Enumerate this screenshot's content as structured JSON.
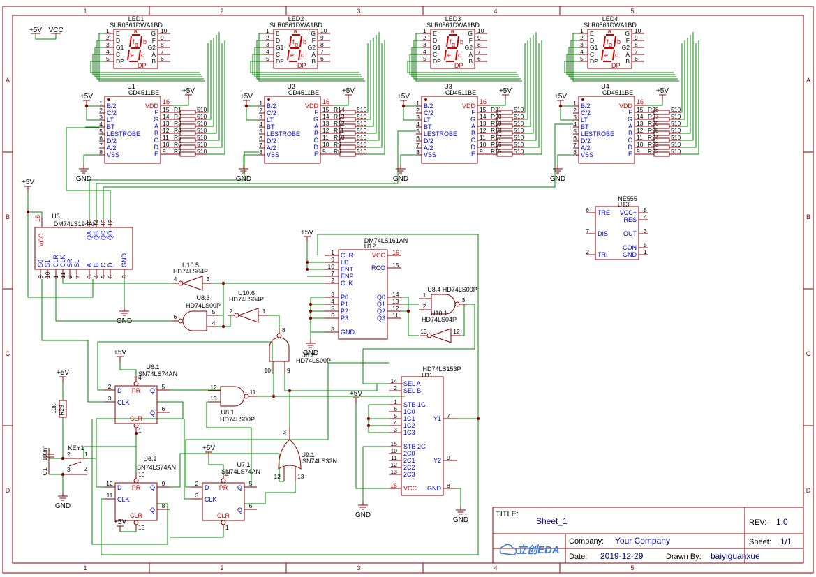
{
  "frame": {
    "columns": [
      "1",
      "2",
      "3",
      "4",
      "5"
    ],
    "rows": [
      "A",
      "B",
      "C",
      "D"
    ]
  },
  "power": {
    "plus5v": "+5V",
    "vcc": "VCC",
    "gnd": "GND"
  },
  "displays": [
    {
      "ref": "LED1",
      "part": "SLR0561DWA1BD"
    },
    {
      "ref": "LED2",
      "part": "SLR0561DWA1BD"
    },
    {
      "ref": "LED3",
      "part": "SLR0561DWA1BD"
    },
    {
      "ref": "LED4",
      "part": "SLR0561DWA1BD"
    }
  ],
  "display_pins": {
    "left_nums": [
      "1",
      "2",
      "3",
      "4",
      "5"
    ],
    "left_names": [
      "E",
      "D",
      "G1",
      "C",
      "DP"
    ],
    "right_names": [
      "G",
      "F",
      "G2",
      "A",
      "B"
    ],
    "right_nums": [
      "10",
      "9",
      "8",
      "7",
      "6"
    ],
    "seg_letters": [
      "a",
      "f",
      "g",
      "b",
      "e",
      "c",
      "DP"
    ]
  },
  "decoders": [
    {
      "ref": "U1",
      "part": "CD4511BE",
      "resistors": [
        "R1",
        "R2",
        "R3",
        "R4",
        "R5",
        "R6",
        "R7"
      ]
    },
    {
      "ref": "U2",
      "part": "CD4511BE",
      "resistors": [
        "R14",
        "R13",
        "R12",
        "R11",
        "R10",
        "R9",
        "R8"
      ]
    },
    {
      "ref": "U3",
      "part": "CD4511BE",
      "resistors": [
        "R21",
        "R20",
        "R19",
        "R18",
        "R17",
        "R16",
        "R15"
      ]
    },
    {
      "ref": "U4",
      "part": "CD4511BE",
      "resistors": [
        "R28",
        "R27",
        "R26",
        "R25",
        "R24",
        "R23",
        "R22"
      ]
    }
  ],
  "decoder_pins": {
    "left_nums": [
      "1",
      "2",
      "3",
      "4",
      "5",
      "6",
      "7",
      "8"
    ],
    "left_names": [
      "B/2",
      "C/2",
      "LT",
      "BT",
      "LESTROBE",
      "D/2",
      "A/2",
      "VSS"
    ],
    "vdd_label": "VDD",
    "vdd_num": "16",
    "right_names": [
      "F",
      "G",
      "A",
      "B",
      "C",
      "D",
      "E"
    ],
    "right_nums": [
      "15",
      "14",
      "13",
      "12",
      "11",
      "10",
      "9"
    ],
    "res_value": "510"
  },
  "u5": {
    "ref": "U5",
    "part": "DM74LS194AN",
    "vcc_label": "VCC",
    "vcc_num": "16",
    "top_names": [
      "QA",
      "QB",
      "QC",
      "QD"
    ],
    "top_nums": [
      "15",
      "14",
      "13",
      "12"
    ],
    "bottom_names": [
      "S0",
      "S1",
      "CLR",
      "CLK",
      "SR",
      "SL",
      "A",
      "B",
      "C",
      "D",
      "GND"
    ],
    "bottom_nums": [
      "9",
      "10",
      "1",
      "11",
      "2",
      "7",
      "3",
      "4",
      "5",
      "6",
      "8"
    ]
  },
  "u12": {
    "ref": "U12",
    "part": "DM74LS161AN",
    "left_names": [
      "CLR",
      "LD",
      "ENT",
      "ENP",
      "CLK",
      "P0",
      "P1",
      "P2",
      "P3",
      "GND"
    ],
    "left_nums": [
      "1",
      "9",
      "10",
      "7",
      "2",
      "3",
      "4",
      "5",
      "6",
      "8"
    ],
    "right_names": [
      "VCC",
      "RCO",
      "Q0",
      "Q1",
      "Q2",
      "Q3"
    ],
    "right_nums": [
      "16",
      "15",
      "14",
      "13",
      "12",
      "11"
    ]
  },
  "u13": {
    "ref": "U13",
    "part": "NE555",
    "left_names": [
      "TRE",
      "DIS",
      "TRI"
    ],
    "left_nums": [
      "6",
      "7",
      "2"
    ],
    "right_names": [
      "VCC+",
      "RES",
      "OUT",
      "CON",
      "GND"
    ],
    "right_nums": [
      "8",
      "4",
      "3",
      "5",
      "1"
    ]
  },
  "u11": {
    "ref": "U11",
    "part": "HD74LS153P",
    "left_names": [
      "SEL A",
      "SEL B",
      "STB 1G",
      "1C0",
      "1C1",
      "1C2",
      "1C3",
      "STB 2G",
      "2C0",
      "2C1",
      "2C2",
      "2C3",
      "VCC"
    ],
    "left_nums": [
      "14",
      "2",
      "1",
      "6",
      "5",
      "4",
      "3",
      "15",
      "10",
      "11",
      "12",
      "13",
      "16"
    ],
    "right_names": [
      "Y1",
      "Y2",
      "GND"
    ],
    "right_nums": [
      "7",
      "9",
      "8"
    ]
  },
  "gates": [
    {
      "ref": "U10.5",
      "part": "HD74LS04P",
      "pins": [
        "4",
        "3"
      ]
    },
    {
      "ref": "U10.6",
      "part": "HD74LS04P",
      "pins": [
        "2",
        "1"
      ]
    },
    {
      "ref": "U8.3",
      "part": "HD74LS00P",
      "pins": [
        "6",
        "5",
        "4"
      ]
    },
    {
      "ref": "U8.4",
      "part": "HD74LS00P",
      "pins": [
        "1",
        "2",
        "3"
      ]
    },
    {
      "ref": "U10.1",
      "part": "HD74LS04P",
      "pins": [
        "13",
        "12"
      ]
    },
    {
      "ref": "U8.2",
      "part": "HD74LS00P",
      "pins": [
        "8",
        "10",
        "9"
      ]
    },
    {
      "ref": "U8.1",
      "part": "HD74LS00P",
      "pins": [
        "12",
        "13",
        "11"
      ]
    },
    {
      "ref": "U9.1",
      "part": "SN74LS32N",
      "pins": [
        "3",
        "12",
        "13"
      ]
    }
  ],
  "flipflops": [
    {
      "ref": "U6.1",
      "part": "SN74LS74AN",
      "pins": {
        "pr": "4",
        "d": "2",
        "q": "5",
        "clk": "3",
        "qn": "6",
        "clr": "1"
      }
    },
    {
      "ref": "U6.2",
      "part": "SN74LS74AN",
      "pins": {
        "pr": "10",
        "d": "12",
        "q": "9",
        "clk": "11",
        "qn": "8",
        "clr": "13"
      }
    },
    {
      "ref": "U7.1",
      "part": "SN74LS74AN",
      "pins": {
        "pr": "4",
        "d": "2",
        "q": "5",
        "clk": "3",
        "qn": "6",
        "clr": "1"
      }
    }
  ],
  "ff_labels": {
    "d": "D",
    "pr": "PR",
    "q": "Q",
    "clk": "CLK",
    "clr": "CLR"
  },
  "r29": {
    "ref": "R29",
    "value": "10k"
  },
  "c1": {
    "ref": "C1",
    "value": "100nf"
  },
  "key1": {
    "ref": "KEY1",
    "pins": [
      "2",
      "1",
      "3",
      "4"
    ]
  },
  "titleblock": {
    "title_label": "TITLE:",
    "title": "Sheet_1",
    "rev_label": "REV:",
    "rev": "1.0",
    "company_label": "Company:",
    "company": "Your Company",
    "sheet_label": "Sheet:",
    "sheet": "1/1",
    "date_label": "Date:",
    "date": "2019-12-29",
    "drawn_label": "Drawn By:",
    "drawn_by": "baiyiguanxue",
    "logo_text": "立创EDA"
  }
}
